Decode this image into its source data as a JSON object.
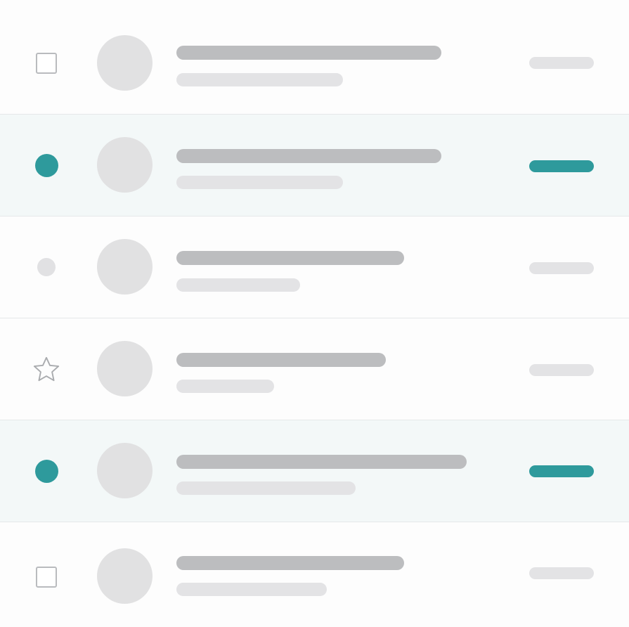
{
  "colors": {
    "accent": "#2e9a9c",
    "placeholder_dark": "#bcbdbf",
    "placeholder_light": "#e3e3e5",
    "selected_row_bg": "#f3f8f8"
  },
  "rows": [
    {
      "lead_icon": "checkbox-unchecked",
      "selected": false,
      "meta_accent": false
    },
    {
      "lead_icon": "selected-dot",
      "selected": true,
      "meta_accent": true
    },
    {
      "lead_icon": "unread-dot",
      "selected": false,
      "meta_accent": false
    },
    {
      "lead_icon": "star-outline",
      "selected": false,
      "meta_accent": false
    },
    {
      "lead_icon": "selected-dot",
      "selected": true,
      "meta_accent": true
    },
    {
      "lead_icon": "checkbox-unchecked",
      "selected": false,
      "meta_accent": false
    }
  ]
}
